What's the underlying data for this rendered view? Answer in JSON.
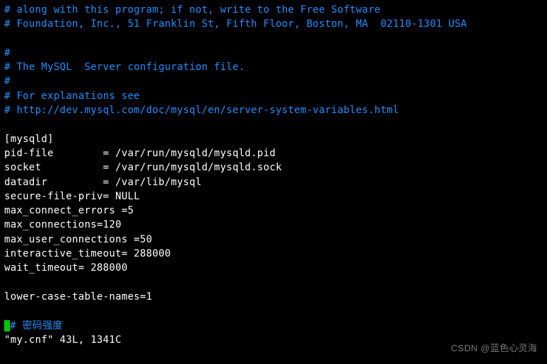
{
  "lines": {
    "c1": "# along with this program; if not, write to the Free Software",
    "c2": "# Foundation, Inc., 51 Franklin St, Fifth Floor, Boston, MA  02110-1301 USA",
    "c3": "#",
    "c4": "# The MySQL  Server configuration file.",
    "c5": "#",
    "c6": "# For explanations see",
    "c7": "# http://dev.mysql.com/doc/mysql/en/server-system-variables.html",
    "section": "[mysqld]",
    "pidfile": "pid-file        = /var/run/mysqld/mysqld.pid",
    "socket": "socket          = /var/run/mysqld/mysqld.sock",
    "datadir": "datadir         = /var/lib/mysql",
    "securefilepriv": "secure-file-priv= NULL",
    "maxconnecterrors": "max_connect_errors =5",
    "maxconnections": "max_connections=120",
    "maxuserconnections": "max_user_connections =50",
    "interactivetimeout": "interactive_timeout= 288000",
    "waittimeout": "wait_timeout= 288000",
    "lowercase": "lower-case-table-names=1",
    "passwordcomment_hash": "#",
    "passwordcomment_text": " 密码强度",
    "status": "\"my.cnf\" 43L, 1341C"
  },
  "watermark": "CSDN @蓝色心灵海"
}
